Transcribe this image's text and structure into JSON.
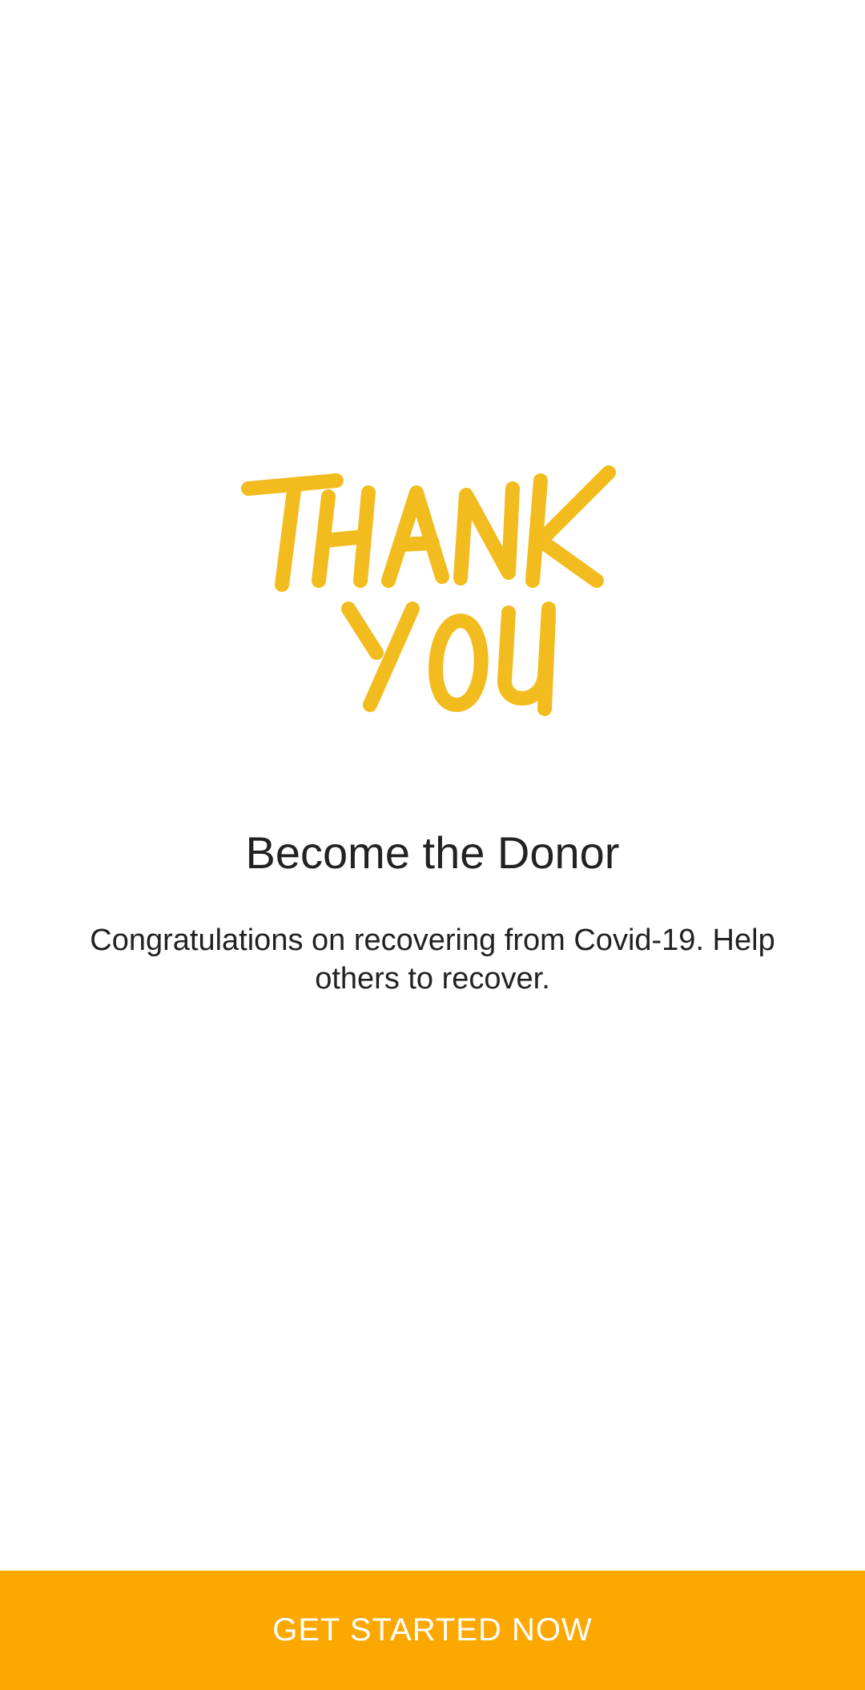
{
  "hero": {
    "image_text_line1": "THANK",
    "image_text_line2": "YOU",
    "image_color": "#F2BC1E"
  },
  "content": {
    "title": "Become the Donor",
    "subtitle": "Congratulations on recovering from Covid-19. Help others to recover."
  },
  "cta": {
    "label": "GET STARTED NOW",
    "background_color": "#FCA800",
    "text_color": "#FFFFFF"
  }
}
